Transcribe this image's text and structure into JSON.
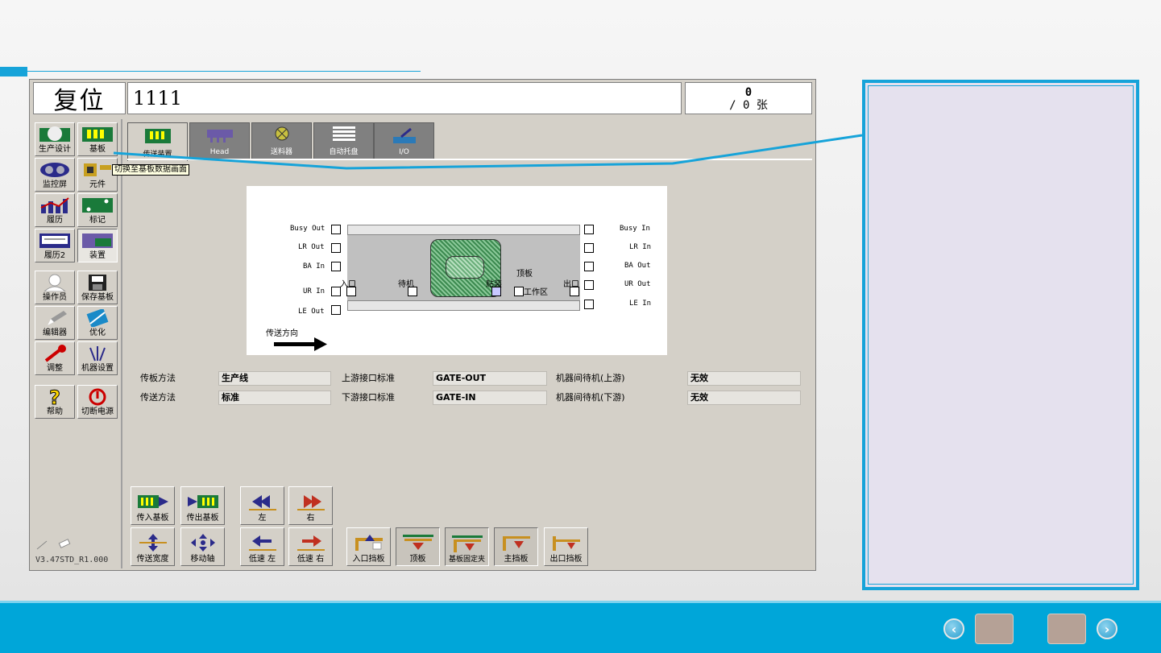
{
  "slide": {
    "accent_color": "#16a3d9",
    "footer_color": "#00a6d9",
    "nav": {
      "prev_icon": "chevron-left-icon",
      "next_icon": "chevron-right-icon",
      "prev_glyph": "‹",
      "next_glyph": "›"
    }
  },
  "header": {
    "status_label": "复位",
    "status_value": "1111",
    "counter_top": "0",
    "counter_bottom": "/ 0 张"
  },
  "sidebar": {
    "items": [
      {
        "label": "生产设计",
        "icon": "production-design-icon"
      },
      {
        "label": "基板",
        "icon": "board-icon"
      },
      {
        "label": "监控屏",
        "icon": "monitor-icon"
      },
      {
        "label": "元件",
        "icon": "component-icon"
      },
      {
        "label": "履历",
        "icon": "history-chart-icon"
      },
      {
        "label": "标记",
        "icon": "mark-icon"
      },
      {
        "label": "履历2",
        "icon": "history2-icon"
      },
      {
        "label": "装置",
        "icon": "device-icon"
      },
      {
        "label": "操作员",
        "icon": "operator-icon"
      },
      {
        "label": "保存基板",
        "icon": "save-disk-icon"
      },
      {
        "label": "编辑器",
        "icon": "editor-icon"
      },
      {
        "label": "优化",
        "icon": "optimize-icon"
      },
      {
        "label": "调整",
        "icon": "wrench-icon"
      },
      {
        "label": "机器设置",
        "icon": "machine-settings-icon"
      },
      {
        "label": "帮助",
        "icon": "help-icon"
      },
      {
        "label": "切断电源",
        "icon": "power-icon"
      }
    ],
    "tooltip": "切换至基板数据画面",
    "version": "V3.47STD_R1.000"
  },
  "tabs": [
    {
      "label": "传送装置",
      "icon": "conveyor-icon"
    },
    {
      "label": "Head",
      "icon": "head-icon"
    },
    {
      "label": "送料器",
      "icon": "feeder-icon"
    },
    {
      "label": "自动托盘",
      "icon": "tray-icon"
    },
    {
      "label": "I/O",
      "icon": "io-icon"
    }
  ],
  "diagram": {
    "left_signals": [
      "Busy Out",
      "LR Out",
      "BA In",
      "UR In",
      "LE Out"
    ],
    "right_signals": [
      "Busy In",
      "LR In",
      "BA Out",
      "UR Out",
      "LE In"
    ],
    "zones": {
      "entry": "入口",
      "wait": "待机",
      "mount": "贴装",
      "work": "工作区",
      "exit": "出口",
      "lift": "顶板"
    },
    "direction_label": "传送方向"
  },
  "settings": {
    "rows": [
      {
        "l1": "传板方法",
        "v1": "生产线",
        "l2": "上游接口标准",
        "v2": "GATE-OUT",
        "l3": "机器间待机(上游)",
        "v3": "无效"
      },
      {
        "l1": "传送方法",
        "v1": "标准",
        "l2": "下游接口标准",
        "v2": "GATE-IN",
        "l3": "机器间待机(下游)",
        "v3": "无效"
      }
    ]
  },
  "buttons": {
    "row1": [
      {
        "label": "传入基板",
        "icon": "board-in-icon"
      },
      {
        "label": "传出基板",
        "icon": "board-out-icon"
      },
      {
        "label": "左",
        "icon": "double-left-arrow-icon"
      },
      {
        "label": "右",
        "icon": "double-right-arrow-icon"
      }
    ],
    "row2": [
      {
        "label": "传送宽度",
        "icon": "width-icon"
      },
      {
        "label": "移动轴",
        "icon": "move-axis-icon"
      },
      {
        "label": "低速 左",
        "icon": "slow-left-icon"
      },
      {
        "label": "低速 右",
        "icon": "slow-right-icon"
      }
    ],
    "stoppers": [
      {
        "label": "入口挡板",
        "icon": "entry-stopper-icon"
      },
      {
        "label": "顶板",
        "icon": "lift-board-icon"
      },
      {
        "label": "基板固定夹",
        "icon": "board-clamp-icon"
      },
      {
        "label": "主挡板",
        "icon": "main-stopper-icon"
      },
      {
        "label": "出口挡板",
        "icon": "exit-stopper-icon"
      }
    ]
  }
}
